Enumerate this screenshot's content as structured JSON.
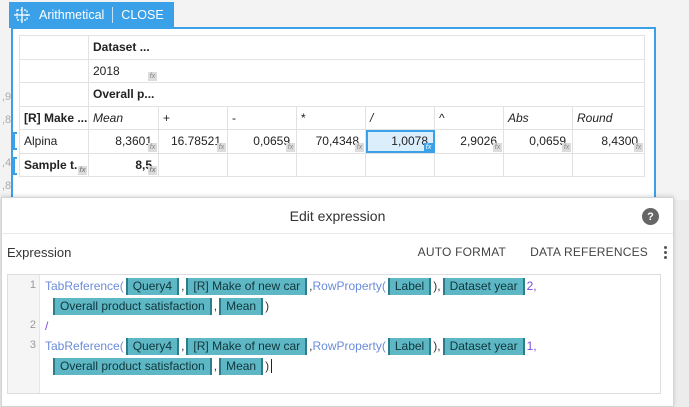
{
  "tag": {
    "label": "Arithmetical",
    "close": "CLOSE"
  },
  "gutter_numbers": [
    ",9",
    ",8",
    ",4",
    ",8"
  ],
  "table": {
    "title_cell": "Dataset ...",
    "year": "2018",
    "overall": "Overall p...",
    "row_header": "[R] Make ...",
    "columns": [
      "Mean",
      "+",
      "-",
      "*",
      "/",
      "^",
      "Abs",
      "Round"
    ],
    "rows": [
      {
        "label": "Alpina",
        "values": [
          "8,3601",
          "16.78521",
          "0,0659",
          "70,4348",
          "1,0078",
          "2,9026",
          "0,0659",
          "8,4300"
        ]
      },
      {
        "label": "Sample t...",
        "values": [
          "8,5",
          "",
          "",
          "",
          "",
          "",
          "",
          ""
        ]
      }
    ]
  },
  "dialog": {
    "title": "Edit expression",
    "help": "?",
    "section": "Expression",
    "auto_format": "AUTO FORMAT",
    "data_refs": "DATA REFERENCES"
  },
  "code": {
    "line_numbers": [
      "1",
      "2",
      "3"
    ],
    "fn_tab": "TabReference(",
    "fn_row": "RowProperty(",
    "chip_query": "Query4",
    "chip_make": "[R] Make of new car",
    "chip_label": "Label",
    "chip_year": "Dataset year",
    "chip_overall": "Overall product satisfaction",
    "chip_mean": "Mean",
    "comma": ",",
    "comma_sp": " ,",
    "close_paren": ")",
    "close_paren_comma": "),",
    "num_2": "2,",
    "num_1": "1,",
    "div": "/"
  }
}
